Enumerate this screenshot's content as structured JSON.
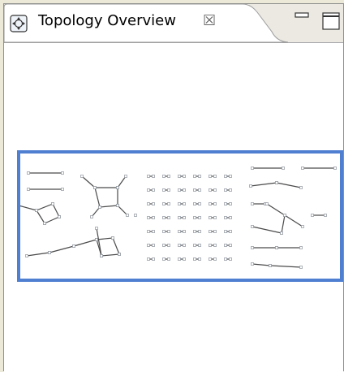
{
  "view": {
    "title": "Topology Overview",
    "icons": {
      "view_icon": "topology-view-icon",
      "close": "close-icon",
      "minimize": "minimize-icon",
      "maximize": "maximize-icon"
    },
    "close_glyph": "☒"
  },
  "overview": {
    "viewport_color": "#4f7fd1",
    "node_color": "#9aa0a8",
    "edge_color": "#4a4a4a"
  }
}
